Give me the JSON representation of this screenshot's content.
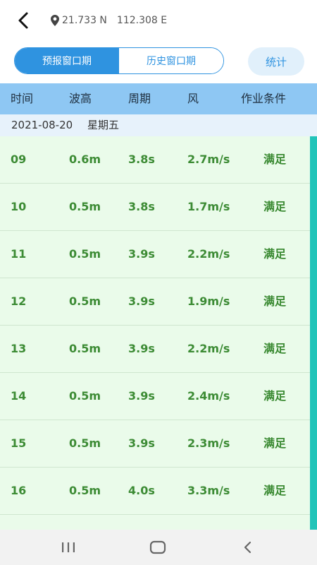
{
  "location": {
    "lat": "21.733 N",
    "lon": "112.308 E"
  },
  "tabs": [
    {
      "label": "预报窗口期",
      "active": true
    },
    {
      "label": "历史窗口期",
      "active": false
    }
  ],
  "stats_button": "统计",
  "table_headers": {
    "time": "时间",
    "wave": "波高",
    "period": "周期",
    "wind": "风",
    "condition": "作业条件"
  },
  "date_row": {
    "date": "2021-08-20",
    "weekday": "星期五"
  },
  "rows": [
    {
      "time": "09",
      "wave": "0.6m",
      "period": "3.8s",
      "wind": "2.7m/s",
      "condition": "满足"
    },
    {
      "time": "10",
      "wave": "0.5m",
      "period": "3.8s",
      "wind": "1.7m/s",
      "condition": "满足"
    },
    {
      "time": "11",
      "wave": "0.5m",
      "period": "3.9s",
      "wind": "2.2m/s",
      "condition": "满足"
    },
    {
      "time": "12",
      "wave": "0.5m",
      "period": "3.9s",
      "wind": "1.9m/s",
      "condition": "满足"
    },
    {
      "time": "13",
      "wave": "0.5m",
      "period": "3.9s",
      "wind": "2.2m/s",
      "condition": "满足"
    },
    {
      "time": "14",
      "wave": "0.5m",
      "period": "3.9s",
      "wind": "2.4m/s",
      "condition": "满足"
    },
    {
      "time": "15",
      "wave": "0.5m",
      "period": "3.9s",
      "wind": "2.3m/s",
      "condition": "满足"
    },
    {
      "time": "16",
      "wave": "0.5m",
      "period": "4.0s",
      "wind": "3.3m/s",
      "condition": "满足"
    },
    {
      "time": "",
      "wave": "",
      "period": "",
      "wind": "",
      "condition": ""
    }
  ],
  "colors": {
    "accent": "#2f93e0",
    "header_bg": "#8ec7f3",
    "row_bg": "#eafbea",
    "row_text": "#3c8b34",
    "scroll_bar": "#22c4b9"
  },
  "icons": {
    "back": "back-arrow-icon",
    "location": "location-pin-icon",
    "nav_recents": "recents-icon",
    "nav_home": "home-icon",
    "nav_back": "nav-back-icon"
  }
}
